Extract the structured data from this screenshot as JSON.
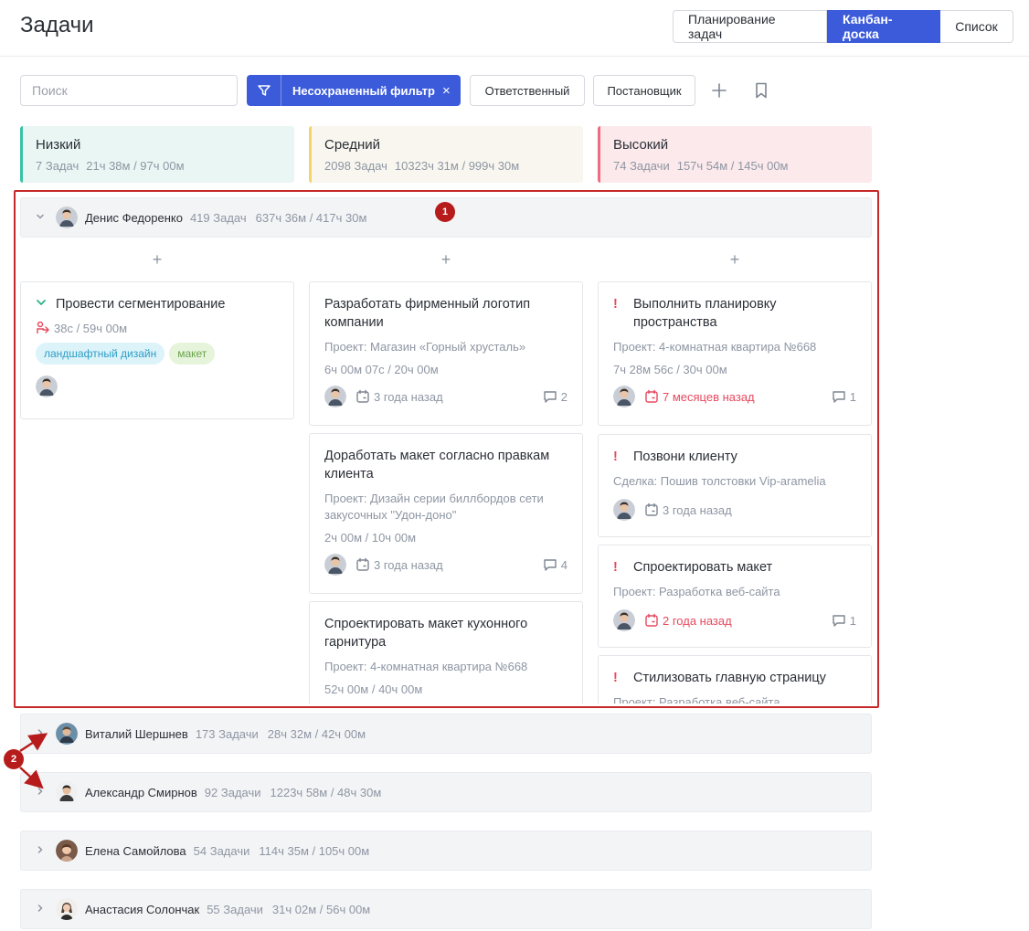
{
  "header": {
    "title": "Задачи",
    "views": [
      "Планирование задач",
      "Канбан-доска",
      "Список"
    ]
  },
  "toolbar": {
    "search_placeholder": "Поиск",
    "filter_label": "Несохраненный фильтр",
    "filter_close": "×",
    "responsible_label": "Ответственный",
    "assigner_label": "Постановщик"
  },
  "columns": [
    {
      "title": "Низкий",
      "count": "7 Задач",
      "hours": "21ч 38м / 97ч 00м",
      "accent": "#39c2a6"
    },
    {
      "title": "Средний",
      "count": "2098 Задач",
      "hours": "10323ч 31м / 999ч 30м",
      "accent": "#f2d46b"
    },
    {
      "title": "Высокий",
      "count": "74 Задачи",
      "hours": "157ч 54м / 145ч 00м",
      "accent": "#ee6b80"
    }
  ],
  "groups": [
    {
      "name": "Денис Федоренко",
      "count": "419 Задач",
      "hours": "637ч 36м / 417ч 30м",
      "expanded": true
    },
    {
      "name": "Виталий Шершнев",
      "count": "173 Задачи",
      "hours": "28ч 32м / 42ч 00м",
      "expanded": false
    },
    {
      "name": "Александр Смирнов",
      "count": "92 Задачи",
      "hours": "1223ч 58м / 48ч 30м",
      "expanded": false
    },
    {
      "name": "Елена Самойлова",
      "count": "54 Задачи",
      "hours": "114ч 35м / 105ч 00м",
      "expanded": false
    },
    {
      "name": "Анастасия Солончак",
      "count": "55 Задачи",
      "hours": "31ч 02м / 56ч 00м",
      "expanded": false
    }
  ],
  "add_symbol": "+",
  "cards": {
    "low": [
      {
        "title": "Провести сегментирование",
        "time": "38с / 59ч 00м",
        "tags": [
          "ландшафтный дизайн",
          "макет"
        ]
      }
    ],
    "mid": [
      {
        "title": "Разработать фирменный логотип компании",
        "project": "Проект: Магазин «Горный хрусталь»",
        "time": "6ч 00м 07с / 20ч 00м",
        "due": "3 года назад",
        "comments": "2"
      },
      {
        "title": "Доработать макет согласно правкам клиента",
        "project": "Проект: Дизайн серии биллбордов сети закусочных \"Удон-доно\"",
        "time": "2ч 00м / 10ч 00м",
        "due": "3 года назад",
        "comments": "4"
      },
      {
        "title": "Спроектировать макет кухонного гарнитура",
        "project": "Проект: 4-комнатная квартира №668",
        "time": "52ч 00м / 40ч 00м"
      }
    ],
    "high": [
      {
        "title": "Выполнить планировку пространства",
        "project": "Проект: 4-комнатная квартира №668",
        "time": "7ч 28м 56с / 30ч 00м",
        "due": "7 месяцев назад",
        "comments": "1"
      },
      {
        "title": "Позвони клиенту",
        "project": "Сделка: Пошив толстовки Vip-aramelia",
        "due": "3 года назад"
      },
      {
        "title": "Спроектировать макет",
        "project": "Проект: Разработка веб-сайта",
        "due": "2 года назад",
        "comments": "1"
      },
      {
        "title": "Стилизовать главную страницу",
        "project": "Проект: Разработка веб-сайта"
      }
    ]
  },
  "annotations": {
    "badge1": "1",
    "badge2": "2"
  },
  "colors": {
    "accent": "#3b5bdb",
    "danger": "#e8485f",
    "highlight": "#c62828"
  }
}
